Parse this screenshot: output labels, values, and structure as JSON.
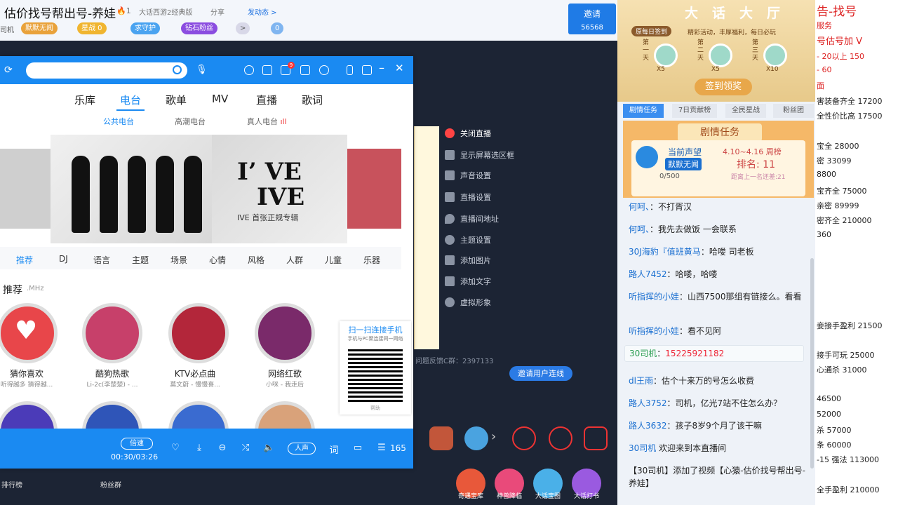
{
  "header": {
    "title": "估价找号帮出号-养娃",
    "heat": "1",
    "category": "大话西游2经典版",
    "share": "分享",
    "dynamic": "发动态 >",
    "row2": {
      "prefix": "司机",
      "tag1": "默默无闻",
      "tag2": "星战 0",
      "tag3": "求守护",
      "tag4": "钻石粉丝",
      "tag5": ">",
      "tag6": "0"
    },
    "invite": {
      "label": "邀请",
      "count": "56568"
    }
  },
  "stream_menu": {
    "close": "关闭直播",
    "items": [
      "显示屏幕选区框",
      "声音设置",
      "直播设置",
      "直播间地址",
      "主题设置",
      "添加图片",
      "添加文字",
      "虚拟形象"
    ],
    "feedback": "问题反馈C群：2397133",
    "lianxian": "邀请用户连线"
  },
  "player": {
    "tabs": [
      "乐库",
      "电台",
      "歌单",
      "MV",
      "直播",
      "歌词"
    ],
    "subtabs": [
      "公共电台",
      "高潮电台",
      "真人电台"
    ],
    "banner": {
      "big1": "I’ VE",
      "big2": "IVE",
      "sub": "IVE 首张正规专辑"
    },
    "categories": [
      "推荐",
      "DJ",
      "语言",
      "主题",
      "场景",
      "心情",
      "风格",
      "人群",
      "儿童",
      "乐器"
    ],
    "rec_title": "推荐",
    "rec_unit": ".MHz",
    "channels": [
      {
        "name": "猜你喜欢",
        "desc": "听得越多 猜得越..."
      },
      {
        "name": "酷狗热歌",
        "desc": "Li-2c(李楚楚) - ..."
      },
      {
        "name": "KTV必点曲",
        "desc": "莫文蔚 - 慢慢喜..."
      },
      {
        "name": "网络红歌",
        "desc": "小咪 - 我走后"
      }
    ],
    "qr": {
      "title": "扫一扫连接手机",
      "sub": "手机与PC聚连接同一网络",
      "help": "帮助"
    },
    "bar": {
      "speed": "倍速",
      "time": "00:30/03:26",
      "voice": "人声",
      "lyric": "词",
      "count": "165"
    },
    "below": {
      "a": "排行榜",
      "b": "粉丝群"
    }
  },
  "gifts": [
    "奇遇宝库",
    "神兽降临",
    "大话宝图",
    "大话打书"
  ],
  "right": {
    "hall": "大话大厅",
    "checkin": "原每日签到",
    "tip": "精彩活动，丰厚福利，每日必玩",
    "days": [
      {
        "d": "第一天",
        "x": "X5"
      },
      {
        "d": "第二天",
        "x": "X5"
      },
      {
        "d": "第三天",
        "x": "X10"
      }
    ],
    "signbtn": "签到领奖",
    "tabs": [
      "剧情任务",
      "7日贡献榜",
      "全民星战",
      "粉丝团"
    ],
    "plot": {
      "title": "剧情任务",
      "sw": "当前声望",
      "swv": "默默无闻",
      "prog": "0/500",
      "range": "4.10~4.16 周榜",
      "rank": "排名: 11",
      "dist": "距离上一名还差:21"
    }
  },
  "chat": [
    {
      "u": "何呵、",
      "t": "：不打胥汉"
    },
    {
      "u": "何呵、",
      "t": "：我先去做饭 一会联系"
    },
    {
      "u": "30J海豹『值班黄马",
      "t": "：哈喽 司老板"
    },
    {
      "u": "路人7452",
      "t": "：哈喽，哈喽"
    },
    {
      "u": "听指挥的小娃",
      "t": "：山西7500那组有链接么。看看"
    },
    {
      "u": "听指挥的小娃",
      "t": "：看不见阿"
    },
    {
      "u": "30司机",
      "t": "：",
      "ph": "15225921182"
    },
    {
      "u": "dl王雨",
      "t": "：估个十来万的号怎么收费"
    },
    {
      "u": "路人3752",
      "t": "：司机，亿光7站不住怎么办？"
    },
    {
      "u": "路人3632",
      "t": "：孩子8岁9个月了该干嘛"
    },
    {
      "u": "30司机",
      "t": " 欢迎来到本直播间"
    },
    {
      "u": "",
      "t": "【30司机】添加了视频【心猿-估价找号帮出号-养娃】"
    }
  ],
  "doc": [
    {
      "t": "告-找号",
      "red": true
    },
    {
      "t": "服务",
      "red": true
    },
    {
      "t": "号估号加 V",
      "red": true
    },
    {
      "t": "- 20以上 150",
      "red": true
    },
    {
      "t": "- 60",
      "red": true
    },
    {
      "t": "面",
      "red": true
    },
    {
      "t": "害装备齐全 17200",
      "red": false
    },
    {
      "t": "全性价比高 17500",
      "red": false
    },
    {
      "t": "宝全 28000",
      "red": false
    },
    {
      "t": "密 33099",
      "red": false
    },
    {
      "t": "8800",
      "red": false
    },
    {
      "t": "宝齐全 75000",
      "red": false
    },
    {
      "t": "亲密 89999",
      "red": false
    },
    {
      "t": "密齐全 210000",
      "red": false
    },
    {
      "t": "360",
      "red": false
    },
    {
      "t": "妾接手盈利 21500",
      "red": false
    },
    {
      "t": "接手可玩 25000",
      "red": false
    },
    {
      "t": "心通杀 31000",
      "red": false
    },
    {
      "t": "46500",
      "red": false
    },
    {
      "t": "52000",
      "red": false
    },
    {
      "t": "杀 57000",
      "red": false
    },
    {
      "t": "条 60000",
      "red": false
    },
    {
      "t": "-15 强法 113000",
      "red": false
    },
    {
      "t": "全手盈利 210000",
      "red": false
    }
  ]
}
